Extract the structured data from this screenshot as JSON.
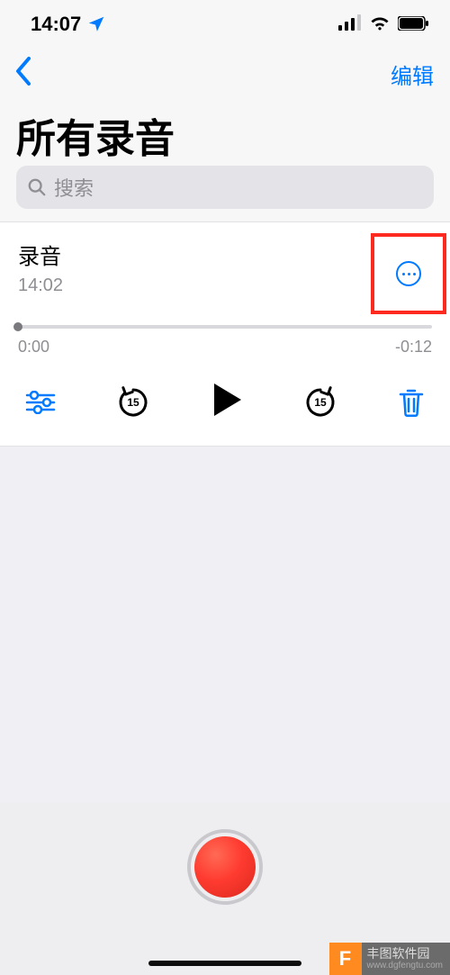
{
  "status": {
    "time": "14:07"
  },
  "nav": {
    "edit": "编辑"
  },
  "title": "所有录音",
  "search": {
    "placeholder": "搜索"
  },
  "recording": {
    "name": "录音",
    "timestamp": "14:02",
    "elapsed": "0:00",
    "remaining": "-0:12",
    "skip_seconds": "15"
  },
  "watermark": {
    "name": "丰图软件园",
    "url": "www.dgfengtu.com"
  }
}
